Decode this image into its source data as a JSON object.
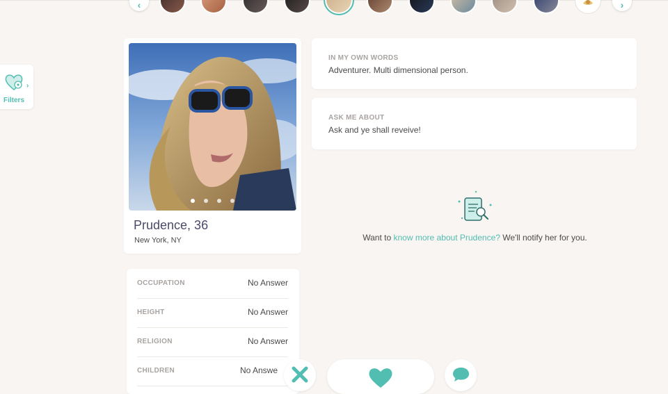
{
  "colors": {
    "accent": "#52bdb1",
    "background": "#f8f5f2",
    "card": "#ffffff",
    "muted_label": "#a8a3a0"
  },
  "top_carousel": {
    "prev_icon": "chevron-left-icon",
    "next_icon": "chevron-right-icon",
    "active_index": 4
  },
  "filters": {
    "label": "Filters",
    "icon": "heart-filter-icon"
  },
  "profile": {
    "name_age": "Prudence, 36",
    "location": "New York, NY",
    "photo_count": 4,
    "photo_index": 1
  },
  "details": [
    {
      "key": "OCCUPATION",
      "value": "No Answer"
    },
    {
      "key": "HEIGHT",
      "value": "No Answer"
    },
    {
      "key": "RELIGION",
      "value": "No Answer"
    },
    {
      "key": "CHILDREN",
      "value": "No Answe"
    }
  ],
  "sections": {
    "own_words": {
      "title": "IN MY OWN WORDS",
      "body": "Adventurer. Multi dimensional person."
    },
    "ask_me": {
      "title": "ASK ME ABOUT",
      "body": "Ask and ye shall reveive!"
    }
  },
  "notify": {
    "prefix": "Want to ",
    "link": "know more about Prudence?",
    "suffix": " We'll notify her for you.",
    "icon": "document-search-icon"
  },
  "actions": {
    "pass_icon": "close-icon",
    "like_icon": "heart-icon",
    "message_icon": "chat-bubble-icon"
  }
}
